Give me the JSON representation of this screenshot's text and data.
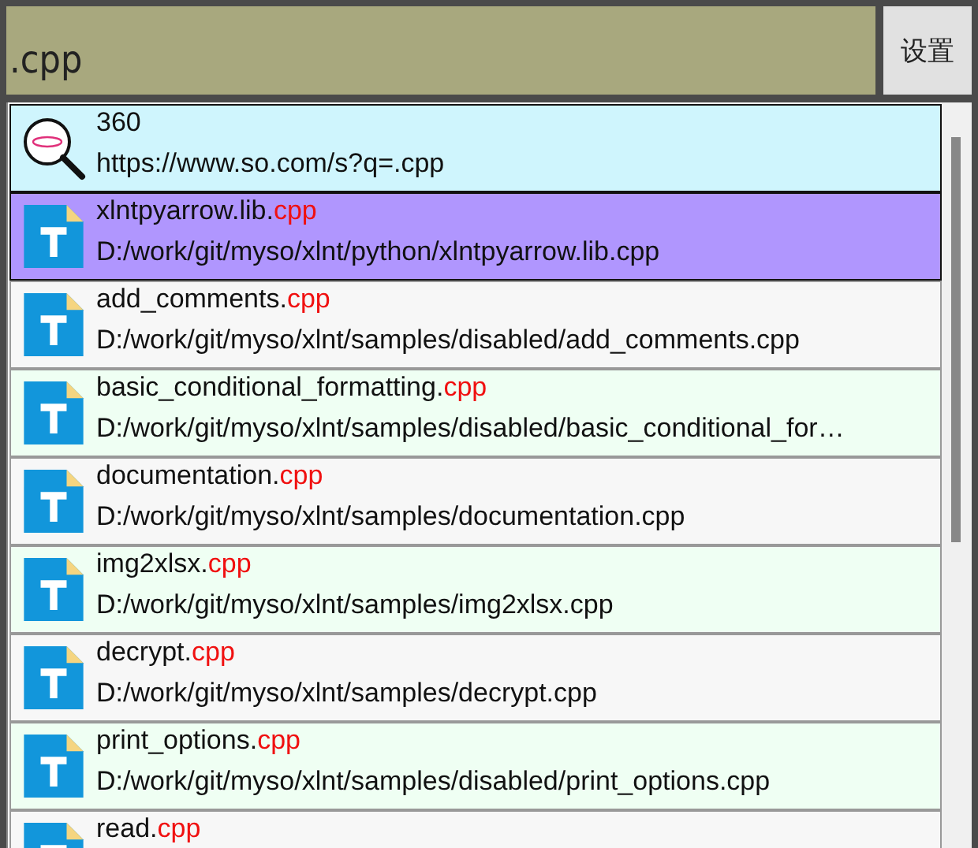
{
  "search": {
    "value": ".cpp"
  },
  "settings_button": "设置",
  "results": [
    {
      "kind": "web",
      "title": "360",
      "subtitle": "https://www.so.com/s?q=.cpp",
      "selected": false
    },
    {
      "kind": "file",
      "title": "xlntpyarrow.lib.",
      "match": "cpp",
      "subtitle": "D:/work/git/myso/xlnt/python/xlntpyarrow.lib.cpp",
      "selected": true
    },
    {
      "kind": "file",
      "title": "add_comments.",
      "match": "cpp",
      "subtitle": "D:/work/git/myso/xlnt/samples/disabled/add_comments.cpp",
      "selected": false
    },
    {
      "kind": "file",
      "title": "basic_conditional_formatting.",
      "match": "cpp",
      "subtitle": "D:/work/git/myso/xlnt/samples/disabled/basic_conditional_for…",
      "selected": false
    },
    {
      "kind": "file",
      "title": "documentation.",
      "match": "cpp",
      "subtitle": "D:/work/git/myso/xlnt/samples/documentation.cpp",
      "selected": false
    },
    {
      "kind": "file",
      "title": "img2xlsx.",
      "match": "cpp",
      "subtitle": "D:/work/git/myso/xlnt/samples/img2xlsx.cpp",
      "selected": false
    },
    {
      "kind": "file",
      "title": "decrypt.",
      "match": "cpp",
      "subtitle": "D:/work/git/myso/xlnt/samples/decrypt.cpp",
      "selected": false
    },
    {
      "kind": "file",
      "title": "print_options.",
      "match": "cpp",
      "subtitle": "D:/work/git/myso/xlnt/samples/disabled/print_options.cpp",
      "selected": false
    },
    {
      "kind": "file",
      "title": "read.",
      "match": "cpp",
      "selected": false
    }
  ]
}
